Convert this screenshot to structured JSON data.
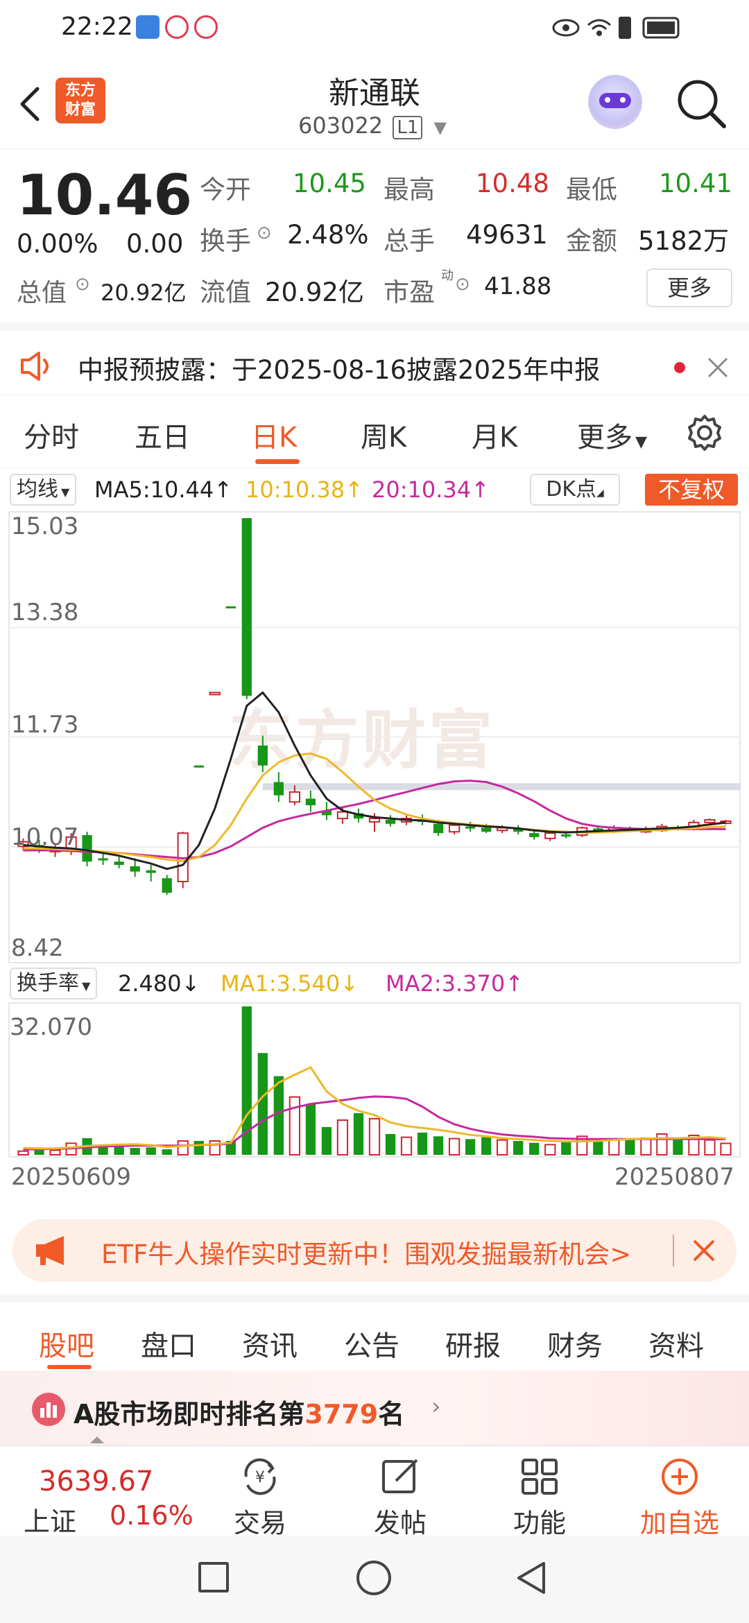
{
  "status_bar": {
    "time": "22:22"
  },
  "header": {
    "logo_line1": "东方",
    "logo_line2": "财富",
    "stock_name": "新通联",
    "stock_code": "603022",
    "market_badge": "L1"
  },
  "quote": {
    "price": "10.46",
    "change_pct": "0.00%",
    "change": "0.00",
    "open_label": "今开",
    "open": "10.45",
    "high_label": "最高",
    "high": "10.48",
    "low_label": "最低",
    "low": "10.41",
    "turnover_label": "换手",
    "turnover": "2.48%",
    "volume_label": "总手",
    "volume": "49631",
    "amount_label": "金额",
    "amount": "5182万",
    "mktcap_label": "总值",
    "mktcap": "20.92亿",
    "float_label": "流值",
    "float_cap": "20.92亿",
    "pe_label": "市盈",
    "pe_sup": "动",
    "pe": "41.88",
    "more": "更多"
  },
  "notice": {
    "text": "中报预披露：于2025-08-16披露2025年中报"
  },
  "chart_tabs": [
    "分时",
    "五日",
    "日K",
    "周K",
    "月K",
    "更多"
  ],
  "active_chart_tab": "日K",
  "kline": {
    "indicator_select": "均线",
    "ma5": "MA5:10.44↑",
    "ma10": "10:10.38↑",
    "ma20": "20:10.34↑",
    "dk_button": "DK点",
    "adjust_button": "不复权",
    "y_labels": [
      "15.03",
      "13.38",
      "11.73",
      "10.07",
      "8.42"
    ],
    "watermark": "东方财富"
  },
  "turnover_panel": {
    "select": "换手率",
    "value": "2.480↓",
    "ma1": "MA1:3.540↓",
    "ma2": "MA2:3.370↑",
    "y_top": "32.070",
    "date_start": "20250609",
    "date_end": "20250807"
  },
  "chart_data": {
    "type": "candlestick",
    "ylim": [
      8.42,
      15.03
    ],
    "candles": [
      {
        "o": 10.08,
        "c": 10.15,
        "h": 10.2,
        "l": 10.02
      },
      {
        "o": 10.1,
        "c": 10.02,
        "h": 10.18,
        "l": 9.98
      },
      {
        "o": 10.0,
        "c": 10.05,
        "h": 10.1,
        "l": 9.92
      },
      {
        "o": 10.04,
        "c": 10.22,
        "h": 10.28,
        "l": 9.95
      },
      {
        "o": 10.25,
        "c": 9.85,
        "h": 10.3,
        "l": 9.78
      },
      {
        "o": 9.9,
        "c": 9.88,
        "h": 9.98,
        "l": 9.8
      },
      {
        "o": 9.85,
        "c": 9.8,
        "h": 9.95,
        "l": 9.75
      },
      {
        "o": 9.78,
        "c": 9.7,
        "h": 9.9,
        "l": 9.62
      },
      {
        "o": 9.72,
        "c": 9.68,
        "h": 9.8,
        "l": 9.55
      },
      {
        "o": 9.6,
        "c": 9.38,
        "h": 9.65,
        "l": 9.35
      },
      {
        "o": 9.55,
        "c": 10.28,
        "h": 10.3,
        "l": 9.45
      },
      {
        "o": 11.3,
        "c": 11.3,
        "h": 11.3,
        "l": 11.3
      },
      {
        "o": 12.4,
        "c": 12.4,
        "h": 12.4,
        "l": 12.4
      },
      {
        "o": 13.7,
        "c": 13.7,
        "h": 13.7,
        "l": 13.7
      },
      {
        "o": 15.03,
        "c": 12.35,
        "h": 15.03,
        "l": 12.3
      },
      {
        "o": 11.6,
        "c": 11.3,
        "h": 11.75,
        "l": 11.2
      },
      {
        "o": 11.05,
        "c": 10.85,
        "h": 11.2,
        "l": 10.75
      },
      {
        "o": 10.75,
        "c": 10.9,
        "h": 11.0,
        "l": 10.7
      },
      {
        "o": 10.8,
        "c": 10.7,
        "h": 10.92,
        "l": 10.6
      },
      {
        "o": 10.62,
        "c": 10.55,
        "h": 10.75,
        "l": 10.48
      },
      {
        "o": 10.5,
        "c": 10.6,
        "h": 10.68,
        "l": 10.42
      },
      {
        "o": 10.58,
        "c": 10.5,
        "h": 10.65,
        "l": 10.44
      },
      {
        "o": 10.45,
        "c": 10.5,
        "h": 10.58,
        "l": 10.3
      },
      {
        "o": 10.48,
        "c": 10.42,
        "h": 10.55,
        "l": 10.38
      },
      {
        "o": 10.45,
        "c": 10.5,
        "h": 10.55,
        "l": 10.4
      },
      {
        "o": 10.48,
        "c": 10.45,
        "h": 10.56,
        "l": 10.4
      },
      {
        "o": 10.42,
        "c": 10.28,
        "h": 10.48,
        "l": 10.24
      },
      {
        "o": 10.3,
        "c": 10.4,
        "h": 10.44,
        "l": 10.26
      },
      {
        "o": 10.38,
        "c": 10.35,
        "h": 10.45,
        "l": 10.3
      },
      {
        "o": 10.36,
        "c": 10.3,
        "h": 10.42,
        "l": 10.28
      },
      {
        "o": 10.32,
        "c": 10.36,
        "h": 10.4,
        "l": 10.28
      },
      {
        "o": 10.34,
        "c": 10.3,
        "h": 10.4,
        "l": 10.26
      },
      {
        "o": 10.28,
        "c": 10.22,
        "h": 10.32,
        "l": 10.18
      },
      {
        "o": 10.2,
        "c": 10.28,
        "h": 10.3,
        "l": 10.16
      },
      {
        "o": 10.26,
        "c": 10.24,
        "h": 10.32,
        "l": 10.2
      },
      {
        "o": 10.25,
        "c": 10.36,
        "h": 10.38,
        "l": 10.22
      },
      {
        "o": 10.35,
        "c": 10.32,
        "h": 10.4,
        "l": 10.28
      },
      {
        "o": 10.3,
        "c": 10.36,
        "h": 10.4,
        "l": 10.28
      },
      {
        "o": 10.34,
        "c": 10.32,
        "h": 10.38,
        "l": 10.3
      },
      {
        "o": 10.3,
        "c": 10.34,
        "h": 10.38,
        "l": 10.28
      },
      {
        "o": 10.32,
        "c": 10.38,
        "h": 10.42,
        "l": 10.3
      },
      {
        "o": 10.36,
        "c": 10.34,
        "h": 10.4,
        "l": 10.32
      },
      {
        "o": 10.34,
        "c": 10.44,
        "h": 10.48,
        "l": 10.32
      },
      {
        "o": 10.44,
        "c": 10.48,
        "h": 10.5,
        "l": 10.4
      },
      {
        "o": 10.45,
        "c": 10.46,
        "h": 10.48,
        "l": 10.41
      }
    ],
    "ma5": [
      10.1,
      10.08,
      10.06,
      10.05,
      10.02,
      9.98,
      9.94,
      9.88,
      9.82,
      9.74,
      9.8,
      10.1,
      10.65,
      11.4,
      12.2,
      12.4,
      12.1,
      11.6,
      11.15,
      10.8,
      10.62,
      10.56,
      10.52,
      10.5,
      10.48,
      10.47,
      10.44,
      10.42,
      10.4,
      10.38,
      10.37,
      10.35,
      10.32,
      10.3,
      10.29,
      10.3,
      10.31,
      10.32,
      10.33,
      10.34,
      10.35,
      10.36,
      10.38,
      10.41,
      10.44
    ],
    "ma10": [
      10.05,
      10.05,
      10.04,
      10.03,
      10.02,
      10.0,
      9.98,
      9.95,
      9.92,
      9.88,
      9.86,
      9.92,
      10.1,
      10.4,
      10.8,
      11.15,
      11.35,
      11.45,
      11.48,
      11.4,
      11.2,
      10.98,
      10.78,
      10.65,
      10.56,
      10.5,
      10.46,
      10.43,
      10.41,
      10.39,
      10.37,
      10.35,
      10.33,
      10.31,
      10.3,
      10.29,
      10.29,
      10.3,
      10.31,
      10.32,
      10.33,
      10.34,
      10.35,
      10.37,
      10.38
    ],
    "ma20": [
      10.02,
      10.02,
      10.02,
      10.01,
      10.0,
      9.99,
      9.98,
      9.96,
      9.94,
      9.92,
      9.9,
      9.92,
      9.98,
      10.08,
      10.22,
      10.36,
      10.46,
      10.52,
      10.57,
      10.62,
      10.67,
      10.72,
      10.78,
      10.84,
      10.9,
      10.96,
      11.02,
      11.06,
      11.07,
      11.05,
      10.98,
      10.88,
      10.76,
      10.62,
      10.5,
      10.42,
      10.38,
      10.36,
      10.35,
      10.34,
      10.34,
      10.34,
      10.34,
      10.34,
      10.34
    ],
    "turnover": [
      0.8,
      1.2,
      1.0,
      2.5,
      3.6,
      2.2,
      1.8,
      1.5,
      1.6,
      1.2,
      3.0,
      3.0,
      3.0,
      3.0,
      32.07,
      22.0,
      17.0,
      12.5,
      11.0,
      6.0,
      7.5,
      9.0,
      7.8,
      4.5,
      3.8,
      4.8,
      4.0,
      3.5,
      3.4,
      3.8,
      3.2,
      3.0,
      2.6,
      2.2,
      2.8,
      4.0,
      3.0,
      3.2,
      3.4,
      3.6,
      4.5,
      3.2,
      4.2,
      3.2,
      2.48
    ],
    "ma1_t": [
      1.5,
      1.4,
      1.4,
      1.6,
      1.9,
      2.1,
      2.2,
      2.3,
      2.1,
      1.7,
      1.9,
      2.1,
      2.3,
      2.6,
      8.6,
      12.6,
      15.6,
      17.3,
      18.9,
      13.7,
      11.0,
      9.5,
      8.6,
      7.0,
      6.2,
      5.8,
      5.4,
      4.9,
      4.3,
      4.0,
      3.6,
      3.4,
      3.2,
      3.0,
      2.9,
      2.9,
      3.0,
      3.2,
      3.4,
      3.5,
      3.6,
      3.6,
      3.7,
      3.8,
      3.54
    ],
    "ma2_t": [
      1.2,
      1.2,
      1.3,
      1.4,
      1.6,
      1.8,
      1.9,
      2.0,
      2.0,
      2.0,
      2.0,
      2.1,
      2.2,
      2.4,
      5.0,
      7.4,
      9.2,
      10.2,
      11.0,
      11.4,
      11.8,
      12.3,
      12.6,
      12.5,
      12.1,
      10.4,
      8.2,
      6.6,
      5.6,
      4.9,
      4.4,
      4.1,
      3.9,
      3.6,
      3.5,
      3.4,
      3.4,
      3.4,
      3.4,
      3.4,
      3.4,
      3.4,
      3.4,
      3.4,
      3.37
    ],
    "turnover_ylim": [
      0,
      32.07
    ],
    "colors": {
      "up": "#c8262b",
      "down": "#179617",
      "ma5": "#222222",
      "ma10": "#f0b729",
      "ma20": "#c6289e"
    }
  },
  "banner": {
    "text": "ETF牛人操作实时更新中！围观发掘最新机会>"
  },
  "sub_tabs": [
    "股吧",
    "盘口",
    "资讯",
    "公告",
    "研报",
    "财务",
    "资料"
  ],
  "active_sub_tab": "股吧",
  "rank": {
    "prefix": "A股市场即时排名第",
    "number": "3779",
    "suffix": "名"
  },
  "bottom_bar": {
    "index_value": "3639.67",
    "index_name": "上证",
    "index_change": "0.16%",
    "trade": "交易",
    "post": "发帖",
    "func": "功能",
    "add": "加自选"
  }
}
